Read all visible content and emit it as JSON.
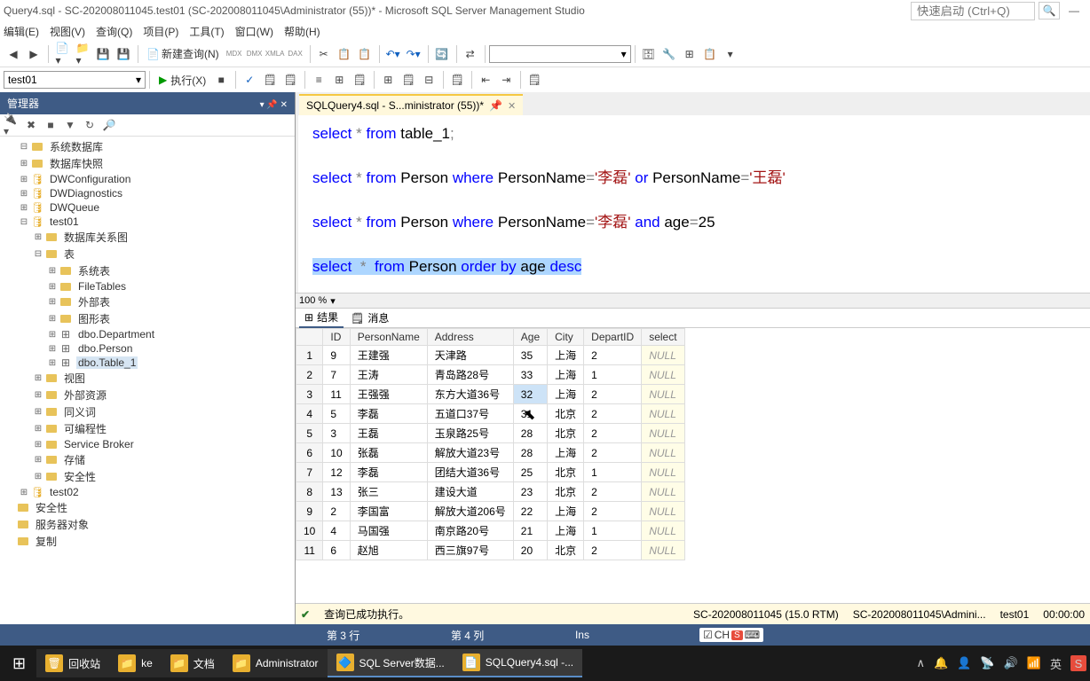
{
  "window_title": "Query4.sql - SC-202008011045.test01 (SC-202008011045\\Administrator (55))* - Microsoft SQL Server Management Studio",
  "quick_launch_placeholder": "快速启动 (Ctrl+Q)",
  "menu": {
    "edit": "编辑(E)",
    "view": "视图(V)",
    "query": "查询(Q)",
    "project": "项目(P)",
    "tools": "工具(T)",
    "window": "窗口(W)",
    "help": "帮助(H)"
  },
  "toolbar": {
    "new_query": "新建查询(N)"
  },
  "toolbar2": {
    "db": "test01",
    "exec": "执行(X)"
  },
  "sidebar": {
    "title": "管理器",
    "items": [
      {
        "indent": 0,
        "exp": "-",
        "icon": "folder",
        "label": "系统数据库"
      },
      {
        "indent": 0,
        "exp": "+",
        "icon": "folder",
        "label": "数据库快照"
      },
      {
        "indent": 0,
        "exp": "+",
        "icon": "db",
        "label": "DWConfiguration"
      },
      {
        "indent": 0,
        "exp": "+",
        "icon": "db",
        "label": "DWDiagnostics"
      },
      {
        "indent": 0,
        "exp": "+",
        "icon": "db",
        "label": "DWQueue"
      },
      {
        "indent": 0,
        "exp": "-",
        "icon": "db",
        "label": "test01"
      },
      {
        "indent": 1,
        "exp": "+",
        "icon": "folder",
        "label": "数据库关系图"
      },
      {
        "indent": 1,
        "exp": "-",
        "icon": "folder",
        "label": "表"
      },
      {
        "indent": 2,
        "exp": "+",
        "icon": "folder",
        "label": "系统表"
      },
      {
        "indent": 2,
        "exp": "+",
        "icon": "folder",
        "label": "FileTables"
      },
      {
        "indent": 2,
        "exp": "+",
        "icon": "folder",
        "label": "外部表"
      },
      {
        "indent": 2,
        "exp": "+",
        "icon": "folder",
        "label": "图形表"
      },
      {
        "indent": 2,
        "exp": "+",
        "icon": "table",
        "label": "dbo.Department"
      },
      {
        "indent": 2,
        "exp": "+",
        "icon": "table",
        "label": "dbo.Person"
      },
      {
        "indent": 2,
        "exp": "+",
        "icon": "table",
        "label": "dbo.Table_1",
        "selected": true
      },
      {
        "indent": 1,
        "exp": "+",
        "icon": "folder",
        "label": "视图"
      },
      {
        "indent": 1,
        "exp": "+",
        "icon": "folder",
        "label": "外部资源"
      },
      {
        "indent": 1,
        "exp": "+",
        "icon": "folder",
        "label": "同义词"
      },
      {
        "indent": 1,
        "exp": "+",
        "icon": "folder",
        "label": "可编程性"
      },
      {
        "indent": 1,
        "exp": "+",
        "icon": "folder",
        "label": "Service Broker"
      },
      {
        "indent": 1,
        "exp": "+",
        "icon": "folder",
        "label": "存储"
      },
      {
        "indent": 1,
        "exp": "+",
        "icon": "folder",
        "label": "安全性"
      },
      {
        "indent": 0,
        "exp": "+",
        "icon": "db",
        "label": "test02"
      },
      {
        "indent": -1,
        "exp": "",
        "icon": "folder",
        "label": "安全性"
      },
      {
        "indent": -1,
        "exp": "",
        "icon": "folder",
        "label": "服务器对象"
      },
      {
        "indent": -1,
        "exp": "",
        "icon": "folder",
        "label": "复制"
      }
    ]
  },
  "tab_label": "SQLQuery4.sql - S...ministrator (55))*",
  "zoom": "100 %",
  "results_tabs": {
    "results": "结果",
    "messages": "消息"
  },
  "grid": {
    "headers": [
      "",
      "ID",
      "PersonName",
      "Address",
      "Age",
      "City",
      "DepartID",
      "select"
    ],
    "rows": [
      [
        "1",
        "9",
        "王建强",
        "天津路",
        "35",
        "上海",
        "2",
        "NULL"
      ],
      [
        "2",
        "7",
        "王涛",
        "青岛路28号",
        "33",
        "上海",
        "1",
        "NULL"
      ],
      [
        "3",
        "11",
        "王强强",
        "东方大道36号",
        "32",
        "上海",
        "2",
        "NULL"
      ],
      [
        "4",
        "5",
        "李磊",
        "五道口37号",
        "31",
        "北京",
        "2",
        "NULL"
      ],
      [
        "5",
        "3",
        "王磊",
        "玉泉路25号",
        "28",
        "北京",
        "2",
        "NULL"
      ],
      [
        "6",
        "10",
        "张磊",
        "解放大道23号",
        "28",
        "上海",
        "2",
        "NULL"
      ],
      [
        "7",
        "12",
        "李磊",
        "团结大道36号",
        "25",
        "北京",
        "1",
        "NULL"
      ],
      [
        "8",
        "13",
        "张三",
        "建设大道",
        "23",
        "北京",
        "2",
        "NULL"
      ],
      [
        "9",
        "2",
        "李国富",
        "解放大道206号",
        "22",
        "上海",
        "2",
        "NULL"
      ],
      [
        "10",
        "4",
        "马国强",
        "南京路20号",
        "21",
        "上海",
        "1",
        "NULL"
      ],
      [
        "11",
        "6",
        "赵旭",
        "西三旗97号",
        "20",
        "北京",
        "2",
        "NULL"
      ]
    ],
    "selected_cell": [
      2,
      4
    ]
  },
  "status": {
    "ok": "✔",
    "msg": "查询已成功执行。",
    "server": "SC-202008011045 (15.0 RTM)",
    "conn": "SC-202008011045\\Admini...",
    "db": "test01",
    "time": "00:00:00"
  },
  "vs_status": {
    "row": "第 3 行",
    "col": "第 4 列",
    "mode": "Ins",
    "ime_lang": "CH"
  },
  "taskbar": {
    "items": [
      {
        "label": "回收站",
        "icon": "🗑"
      },
      {
        "label": "ke",
        "icon": "📁"
      },
      {
        "label": "文档",
        "icon": "📁"
      },
      {
        "label": "Administrator",
        "icon": "📁"
      },
      {
        "label": "SQL Server数据...",
        "icon": "🔷",
        "active": true
      },
      {
        "label": "SQLQuery4.sql -...",
        "icon": "📄",
        "active": true
      }
    ],
    "tray_lang": "英"
  }
}
